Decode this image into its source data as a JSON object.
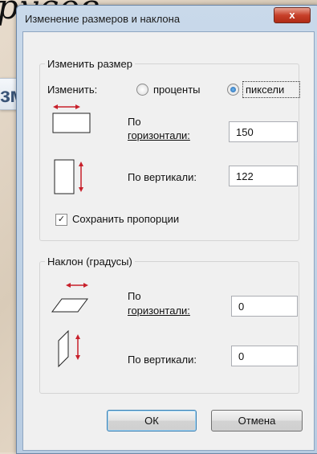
{
  "background": {
    "slide_text": "русов.",
    "card_text": "змер"
  },
  "dialog": {
    "title": "Изменение размеров и наклона",
    "close_label": "x",
    "resize": {
      "legend": "Изменить размер",
      "mode_label": "Изменить:",
      "option_percent": "проценты",
      "option_pixels": "пиксели",
      "selected": "pixels",
      "horizontal_label_1": "По",
      "horizontal_label_2": "горизонтали:",
      "horizontal_value": "150",
      "vertical_label": "По вертикали:",
      "vertical_value": "122",
      "keep_ratio_label": "Сохранить пропорции",
      "keep_ratio_checked": true
    },
    "skew": {
      "legend": "Наклон (градусы)",
      "horizontal_label_1": "По",
      "horizontal_label_2": "горизонтали:",
      "horizontal_value": "0",
      "vertical_label": "По вертикали:",
      "vertical_value": "0"
    },
    "ok_label": "ОК",
    "cancel_label": "Отмена"
  },
  "colors": {
    "arrow": "#c8202b",
    "title_bar": "#c9d9ea",
    "close": "#c7402a"
  }
}
